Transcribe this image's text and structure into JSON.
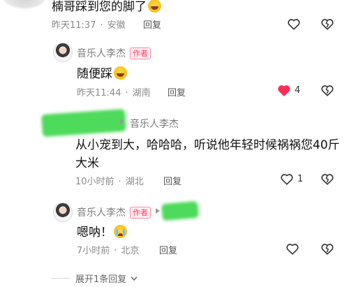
{
  "comments": [
    {
      "text": "楠哥踩到您的脚了",
      "time": "昨天11:37",
      "location": "安徽",
      "reply_label": "回复"
    },
    {
      "author": "音乐人李杰",
      "badge": "作者",
      "text": "随便踩",
      "time": "昨天11:44",
      "location": "湖南",
      "reply_label": "回复",
      "like_count": "4"
    },
    {
      "reply_to": "音乐人李杰",
      "text_line1": "从小宠到大，哈哈哈，听说他年轻时候祸祸您40斤",
      "text_line2": "大米",
      "time": "10小时前",
      "location": "湖北",
      "reply_label": "回复",
      "like_count": "1"
    },
    {
      "author": "音乐人李杰",
      "badge": "作者",
      "text": "嗯呐！",
      "time": "7小时前",
      "location": "北京",
      "reply_label": "回复"
    }
  ],
  "expand_replies": "展开1条回复",
  "colors": {
    "like_red": "#ff2d55",
    "badge_red": "#ff3d5a",
    "redaction_green": "#3bd64a"
  },
  "icons": [
    "heart-outline-icon",
    "heart-filled-icon",
    "broken-heart-icon",
    "reply-arrow-icon",
    "chevron-down-icon",
    "laugh-emoji-icon",
    "cry-emoji-icon"
  ]
}
